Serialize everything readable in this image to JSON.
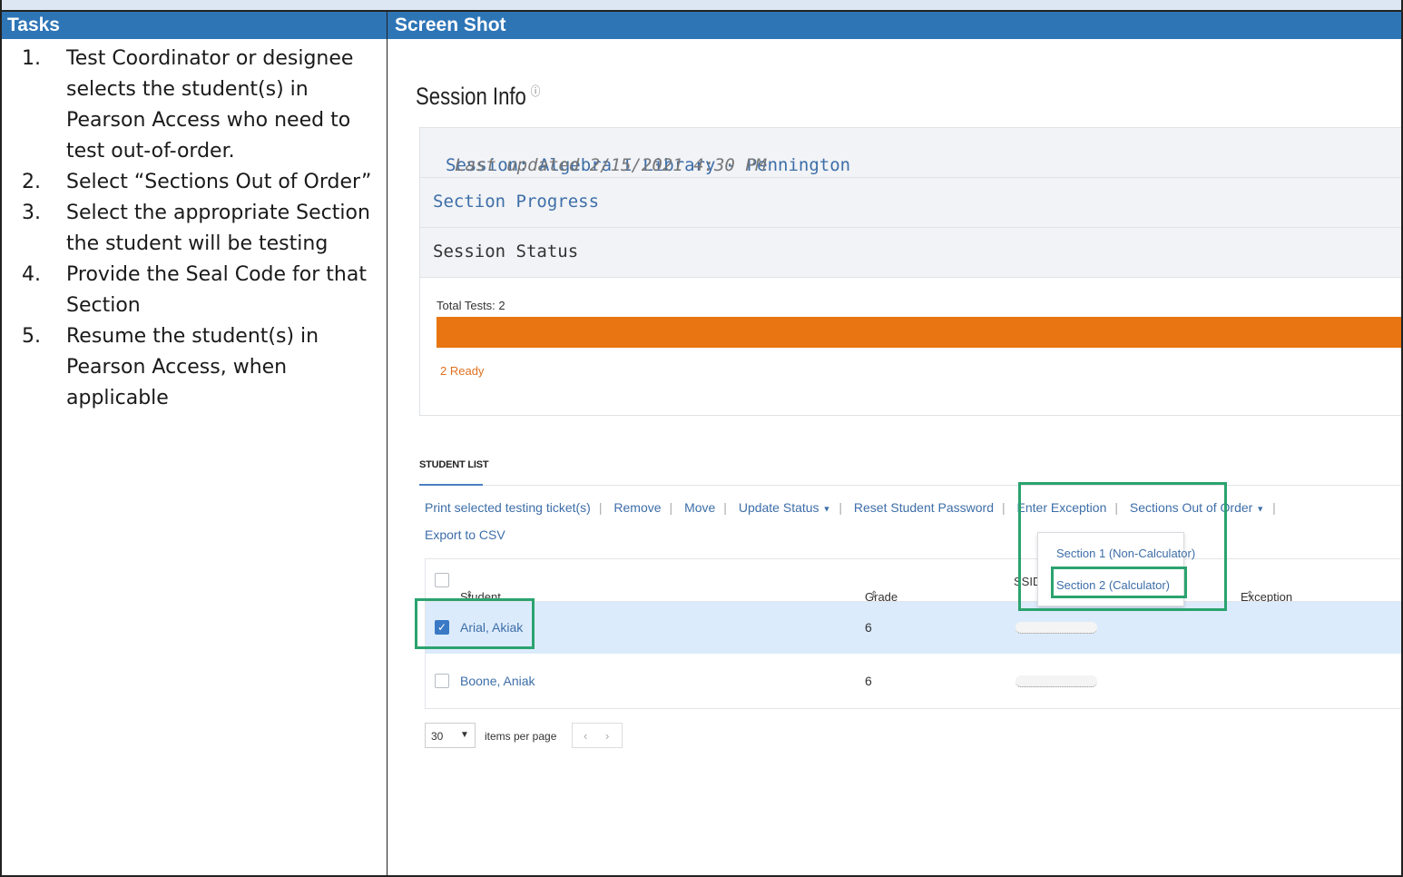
{
  "headers": {
    "tasks": "Tasks",
    "screenshot": "Screen Shot"
  },
  "tasks": [
    {
      "num": "1.",
      "text": "Test Coordinator or designee selects the student(s) in Pearson Access who need to test out-of-order."
    },
    {
      "num": "2.",
      "text": "Select “Sections Out of Order”"
    },
    {
      "num": "3.",
      "text": "Select the appropriate Section the student will be testing"
    },
    {
      "num": "4.",
      "text": "Provide the Seal Code for that Section"
    },
    {
      "num": "5.",
      "text": "Resume the student(s) in Pearson Access, when applicable"
    }
  ],
  "screen": {
    "title": "Session Info",
    "info_icon": "ⓘ",
    "session_label": "Session: Algebra I Library - Pennington",
    "last_updated": "Last updated 2/15/2021 4:30 PM",
    "section_progress": "Section Progress",
    "session_status": "Session Status",
    "total_tests": "Total Tests: 2",
    "ready": "2 Ready",
    "student_list_label": "STUDENT LIST",
    "toolbar": {
      "print": "Print selected testing ticket(s)",
      "remove": "Remove",
      "move": "Move",
      "update_status": "Update Status",
      "reset_password": "Reset Student Password",
      "enter_exception": "Enter Exception",
      "sections_out_of_order": "Sections Out of Order",
      "export": "Export to CSV"
    },
    "dropdown": [
      "Section 1 (Non-Calculator)",
      "Section 2 (Calculator)"
    ],
    "columns": {
      "name": "Student Name",
      "grade": "Grade",
      "ssid": "SSID",
      "exception": "Exception"
    },
    "rows": [
      {
        "name": "Arial, Akiak",
        "grade": "6",
        "checked": true
      },
      {
        "name": "Boone, Aniak",
        "grade": "6",
        "checked": false
      }
    ],
    "pager": {
      "per_page": "30",
      "label": "items per page"
    }
  }
}
